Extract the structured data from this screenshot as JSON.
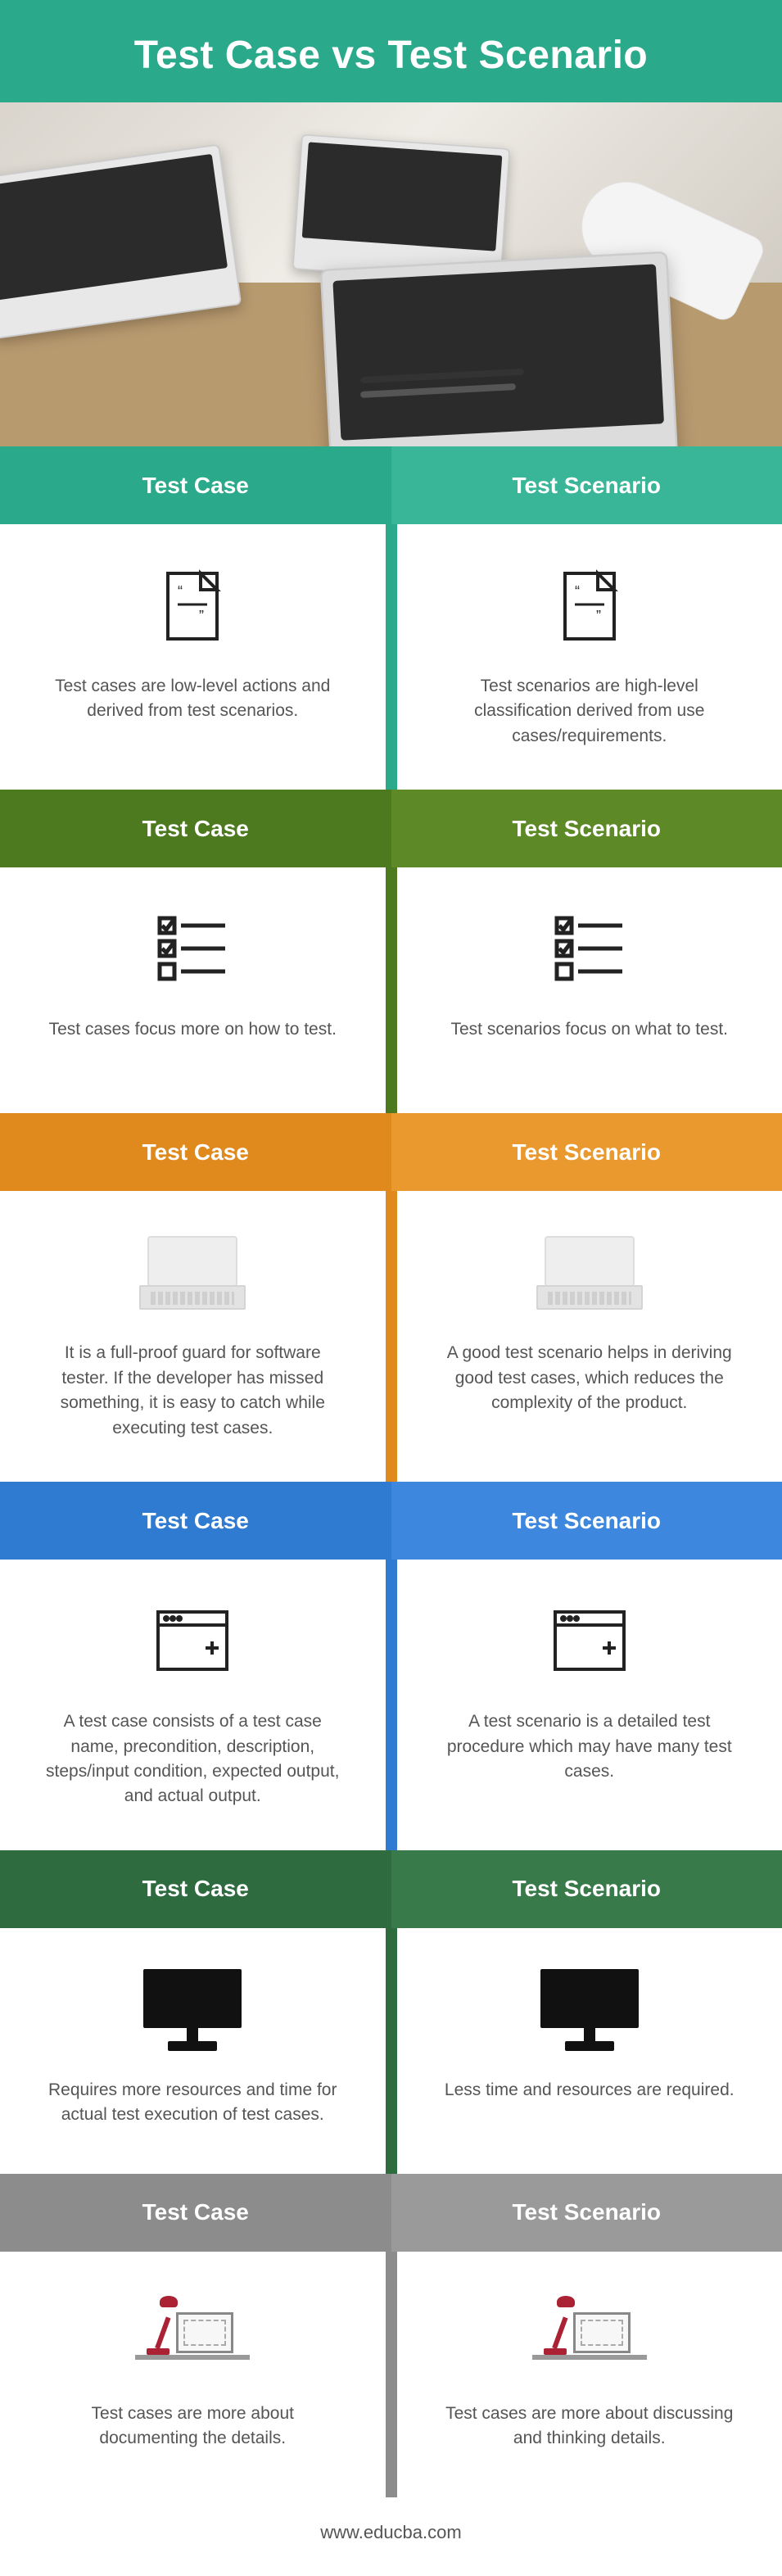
{
  "title": "Test Case vs Test Scenario",
  "left_label": "Test Case",
  "right_label": "Test Scenario",
  "sections": [
    {
      "left_text": "Test cases are low-level actions and derived from test scenarios.",
      "right_text": "Test scenarios are high-level classification derived from use cases/requirements."
    },
    {
      "left_text": "Test cases focus more on how to test.",
      "right_text": "Test scenarios focus on what to test."
    },
    {
      "left_text": "It is a full-proof guard for software tester. If the developer has missed something, it is easy to catch while executing test cases.",
      "right_text": "A good test scenario helps in deriving good test cases, which reduces the complexity of the product."
    },
    {
      "left_text": "A test case consists of a test case name, precondition, description, steps/input condition, expected output, and actual output.",
      "right_text": "A test scenario is a detailed test procedure which may have many test cases."
    },
    {
      "left_text": "Requires more resources and time for actual test execution of test cases.",
      "right_text": "Less time and resources are required."
    },
    {
      "left_text": "Test cases are more about documenting the details.",
      "right_text": "Test cases are more about discussing and thinking details."
    }
  ],
  "footer": "www.educba.com"
}
